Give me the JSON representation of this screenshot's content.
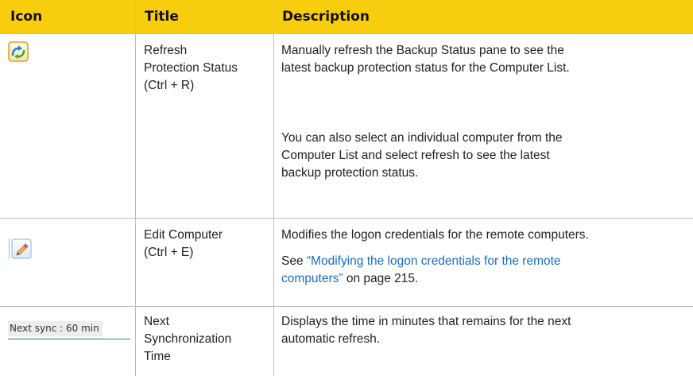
{
  "headers": {
    "icon": "Icon",
    "title": "Title",
    "description": "Description"
  },
  "rows": [
    {
      "icon": "refresh-icon",
      "title_lines": [
        "Refresh",
        "Protection Status",
        "(Ctrl + R)"
      ],
      "desc1_lines": [
        "Manually refresh the Backup Status pane to see the",
        "latest backup protection status for the Computer List."
      ],
      "desc2_lines": [
        "You can also select an individual computer from the",
        "Computer List and select refresh to see the latest",
        "backup protection status."
      ]
    },
    {
      "icon": "edit-pencil-icon",
      "title_lines": [
        "Edit Computer",
        "(Ctrl + E)"
      ],
      "desc1_lines": [
        "Modifies the logon credentials for the remote computers."
      ],
      "see_prefix": "See ",
      "link_line1": "“Modifying the logon credentials for the remote",
      "link_line2": "computers”",
      "page_ref": " on page 215."
    },
    {
      "icon_text": "Next sync : 60 min",
      "title_lines": [
        "Next",
        "Synchronization",
        "Time"
      ],
      "desc1_lines": [
        "Displays the time in minutes that remains for the next",
        "automatic refresh."
      ]
    }
  ],
  "colors": {
    "header_bg": "#f7cd0d",
    "link": "#1a6ec2",
    "rule": "#bdbdbd"
  }
}
